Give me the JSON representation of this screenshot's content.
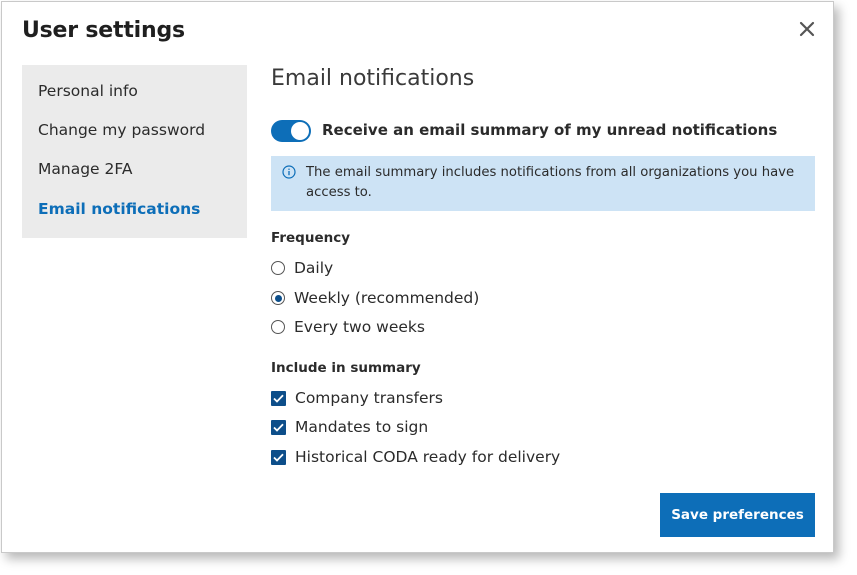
{
  "modal": {
    "title": "User settings",
    "close_icon": "close-icon"
  },
  "sidebar": {
    "items": [
      {
        "label": "Personal info",
        "active": false
      },
      {
        "label": "Change my password",
        "active": false
      },
      {
        "label": "Manage 2FA",
        "active": false
      },
      {
        "label": "Email notifications",
        "active": true
      }
    ]
  },
  "content": {
    "title": "Email notifications",
    "toggle": {
      "label": "Receive an email summary of my unread notifications",
      "on": true
    },
    "info": {
      "icon": "info-icon",
      "text": "The email summary includes notifications from all organizations you have access to."
    },
    "frequency": {
      "label": "Frequency",
      "options": [
        {
          "label": "Daily",
          "selected": false
        },
        {
          "label": "Weekly (recommended)",
          "selected": true
        },
        {
          "label": "Every two weeks",
          "selected": false
        }
      ]
    },
    "include": {
      "label": "Include in summary",
      "options": [
        {
          "label": "Company transfers",
          "checked": true
        },
        {
          "label": "Mandates to sign",
          "checked": true
        },
        {
          "label": "Historical CODA ready for delivery",
          "checked": true
        }
      ]
    },
    "save_label": "Save preferences"
  },
  "colors": {
    "accent": "#0d6eb8",
    "control": "#0d4e8a",
    "info_bg": "#cde3f5",
    "sidebar_bg": "#ebebeb"
  }
}
